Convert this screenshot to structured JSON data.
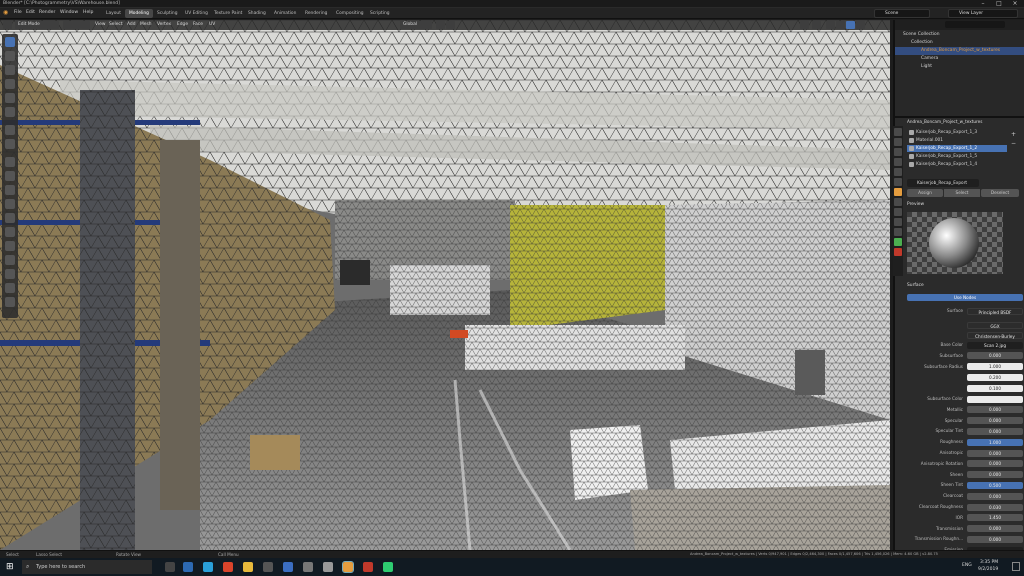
{
  "window": {
    "title": "Blender* [C:\\Photogrammetry\\VS\\Warehouse.blend]"
  },
  "topbar": {
    "menus": [
      "File",
      "Edit",
      "Render",
      "Window",
      "Help"
    ],
    "workspaces": [
      "Layout",
      "Modeling",
      "Sculpting",
      "UV Editing",
      "Texture Paint",
      "Shading",
      "Animation",
      "Rendering",
      "Compositing",
      "Scripting"
    ],
    "active_workspace": "Modeling",
    "scene": "Scene",
    "view_layer": "View Layer"
  },
  "viewport_header": {
    "mode": "Edit Mode",
    "menus": [
      "View",
      "Select",
      "Add",
      "Mesh",
      "Vertex",
      "Edge",
      "Face",
      "UV"
    ],
    "orientation": "Global"
  },
  "outliner": {
    "rows": [
      "Scene Collection",
      "Collection",
      "Andrea_Boncam_Project_w_textures",
      "Camera",
      "Light"
    ]
  },
  "material_panel": {
    "object_name": "Andrea_Boncam_Project_w_textures",
    "slots": [
      "Kaiserjob_Recap_Export_1_3",
      "Material.001",
      "Kaiserjob_Recap_Export_1_2",
      "Kaiserjob_Recap_Export_1_5",
      "Kaiserjob_Recap_Export_1_4"
    ],
    "selected_slot": 2,
    "material_field": "Kaiserjob_Recap_Export",
    "assign": "Assign",
    "select": "Select",
    "deselect": "Deselect",
    "preview_label": "Preview",
    "surface_label": "Surface",
    "use_nodes": "Use Nodes",
    "surface_shader": "Principled BSDF",
    "distribution": "GGX",
    "subsurface_method": "Christensen-Burley"
  },
  "principled": [
    {
      "label": "Base Color",
      "value": "Scan 2.jpg",
      "style": "dark"
    },
    {
      "label": "Subsurface",
      "value": "0.000",
      "style": ""
    },
    {
      "label": "Subsurface Radius",
      "value": "1.000",
      "style": "white"
    },
    {
      "label": "",
      "value": "0.200",
      "style": "white"
    },
    {
      "label": "",
      "value": "0.100",
      "style": "white"
    },
    {
      "label": "Subsurface Color",
      "value": "",
      "style": "white"
    },
    {
      "label": "Metallic",
      "value": "0.000",
      "style": ""
    },
    {
      "label": "Specular",
      "value": "0.000",
      "style": ""
    },
    {
      "label": "Specular Tint",
      "value": "0.000",
      "style": ""
    },
    {
      "label": "Roughness",
      "value": "1.000",
      "style": "blue"
    },
    {
      "label": "Anisotropic",
      "value": "0.000",
      "style": ""
    },
    {
      "label": "Anisotropic Rotation",
      "value": "0.000",
      "style": ""
    },
    {
      "label": "Sheen",
      "value": "0.000",
      "style": ""
    },
    {
      "label": "Sheen Tint",
      "value": "0.500",
      "style": "blue"
    },
    {
      "label": "Clearcoat",
      "value": "0.000",
      "style": ""
    },
    {
      "label": "Clearcoat Roughness",
      "value": "0.030",
      "style": ""
    },
    {
      "label": "IOR",
      "value": "1.450",
      "style": ""
    },
    {
      "label": "Transmission",
      "value": "0.000",
      "style": ""
    },
    {
      "label": "Transmission Roughn...",
      "value": "0.000",
      "style": ""
    },
    {
      "label": "Emission",
      "value": "",
      "style": "dark"
    },
    {
      "label": "Alpha",
      "value": "1.000",
      "style": "blue"
    },
    {
      "label": "Normal",
      "value": "Default",
      "style": "dd"
    }
  ],
  "statusbar": {
    "left": "Select",
    "box": "Lasso Select",
    "rotate": "Rotate View",
    "menu": "Call Menu",
    "stats": "Andrea_Boncam_Project_w_textures | Verts 0/947,901 | Edges 0/2,464,300 | Faces 0/1,457,606 | Tris 1,456,026 | Mem: 4.60 GB | v2.80.75"
  },
  "taskbar": {
    "search": "Type here to search",
    "time": "3:35 PM",
    "date": "9/2/2019",
    "lang": "ENG"
  },
  "colors": {
    "accent": "#4772b3",
    "active_object": "#e59d3f"
  }
}
